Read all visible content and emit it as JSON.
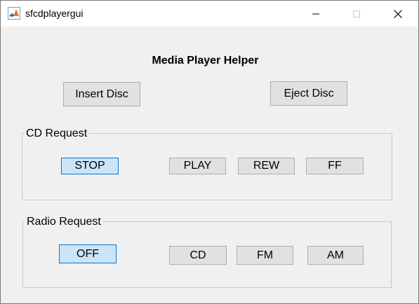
{
  "window": {
    "title": "sfcdplayergui"
  },
  "heading": "Media Player Helper",
  "disc_buttons": {
    "insert": "Insert Disc",
    "eject": "Eject Disc"
  },
  "cd_panel": {
    "title": "CD Request",
    "buttons": [
      "STOP",
      "PLAY",
      "REW",
      "FF"
    ],
    "selected": "STOP"
  },
  "radio_panel": {
    "title": "Radio Request",
    "buttons": [
      "OFF",
      "CD",
      "FM",
      "AM"
    ],
    "selected": "OFF"
  },
  "icons": {
    "app": "matlab-icon",
    "minimize": "minimize-icon",
    "maximize": "maximize-icon",
    "close": "close-icon"
  },
  "colors": {
    "button_bg": "#e1e1e1",
    "selected_bg": "#cce4f7",
    "selected_border": "#0078d7",
    "window_bg": "#f0f0f0"
  }
}
